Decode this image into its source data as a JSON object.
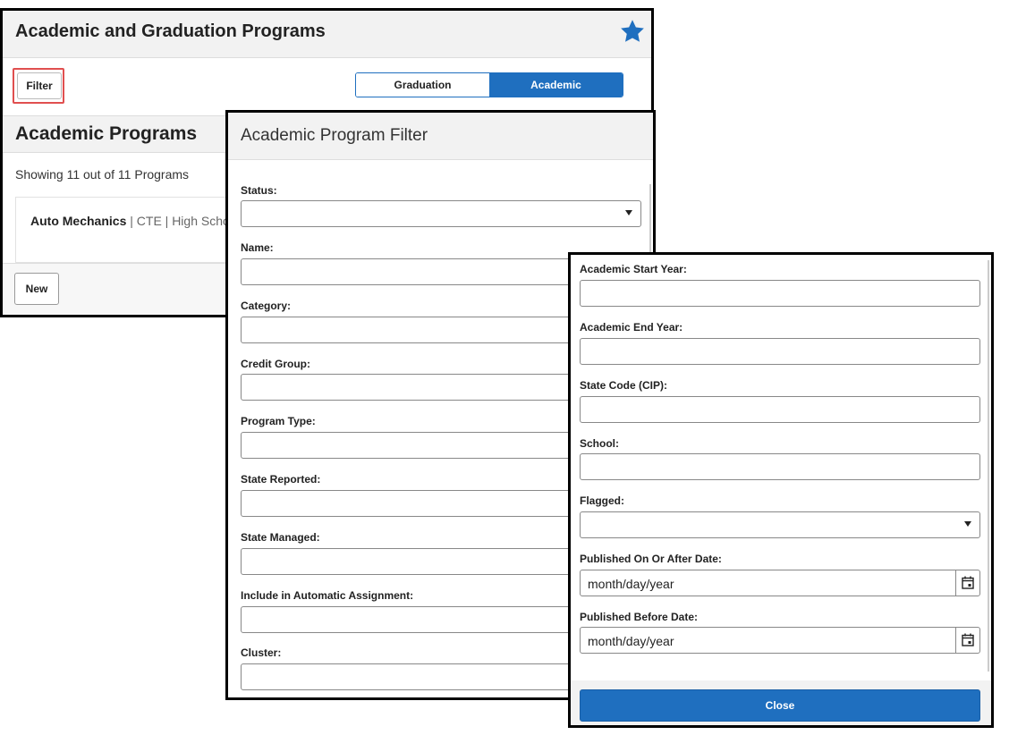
{
  "main": {
    "title": "Academic and Graduation Programs",
    "filter_label": "Filter",
    "tabs": [
      {
        "label": "Graduation",
        "active": false
      },
      {
        "label": "Academic",
        "active": true
      }
    ],
    "section_title": "Academic Programs",
    "showing_text": "Showing 11 out of 11 Programs",
    "item": {
      "name": "Auto Mechanics",
      "meta": " | CTE | High Schoo"
    },
    "new_label": "New"
  },
  "filter_panel": {
    "title": "Academic Program Filter",
    "fields": [
      {
        "label": "Status:",
        "type": "select"
      },
      {
        "label": "Name:",
        "type": "text"
      },
      {
        "label": "Category:",
        "type": "text"
      },
      {
        "label": "Credit Group:",
        "type": "text"
      },
      {
        "label": "Program Type:",
        "type": "text"
      },
      {
        "label": "State Reported:",
        "type": "text"
      },
      {
        "label": "State Managed:",
        "type": "text"
      },
      {
        "label": "Include in Automatic Assignment:",
        "type": "text"
      },
      {
        "label": "Cluster:",
        "type": "text"
      }
    ]
  },
  "filter_panel_2": {
    "fields": [
      {
        "label": "Academic Start Year:",
        "type": "text"
      },
      {
        "label": "Academic End Year:",
        "type": "text"
      },
      {
        "label": "State Code (CIP):",
        "type": "text"
      },
      {
        "label": "School:",
        "type": "text"
      },
      {
        "label": "Flagged:",
        "type": "select"
      },
      {
        "label": "Published On Or After Date:",
        "type": "date",
        "placeholder": "month/day/year"
      },
      {
        "label": "Published Before Date:",
        "type": "date",
        "placeholder": "month/day/year"
      }
    ],
    "close_label": "Close"
  },
  "colors": {
    "accent": "#1f6fbf",
    "highlight": "#e04f4f"
  },
  "icons": [
    "star-icon",
    "calendar-icon",
    "caret-down-icon"
  ]
}
